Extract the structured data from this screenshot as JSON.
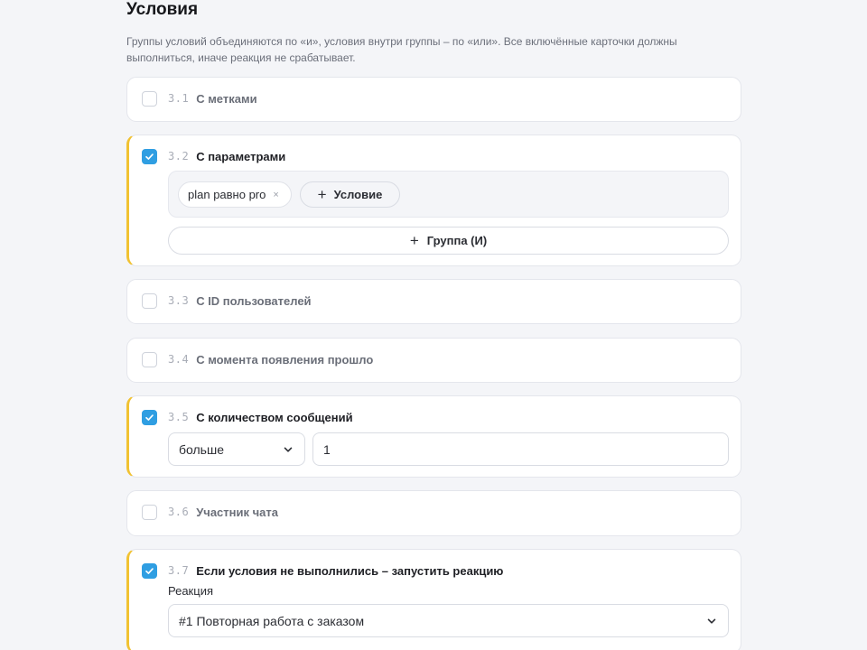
{
  "header": {
    "title": "Условия",
    "description": "Группы условий объединяются по «и», условия внутри группы – по «или». Все включённые карточки должны выполниться, иначе реакция не срабатывает."
  },
  "cards": [
    {
      "num": "3.1",
      "label": "С метками",
      "checked": false
    },
    {
      "num": "3.2",
      "label": "С параметрами",
      "checked": true
    },
    {
      "num": "3.3",
      "label": "С ID пользователей",
      "checked": false
    },
    {
      "num": "3.4",
      "label": "С момента появления прошло",
      "checked": false
    },
    {
      "num": "3.5",
      "label": "С количеством сообщений",
      "checked": true
    },
    {
      "num": "3.6",
      "label": "Участник чата",
      "checked": false
    },
    {
      "num": "3.7",
      "label": "Если условия не выполнились – запустить реакцию",
      "checked": true
    }
  ],
  "params": {
    "chip_label": "plan равно pro",
    "chip_remove": "×",
    "add_condition_icon": "+",
    "add_condition": "Условие",
    "add_group_icon": "+",
    "add_group": "Группа (И)"
  },
  "messages": {
    "operator": "больше",
    "value": "1"
  },
  "reaction": {
    "label": "Реакция",
    "selected": "#1 Повторная работа с заказом"
  },
  "colors": {
    "accent": "#2f9ee2",
    "active_border": "#f1c232"
  },
  "icons": {
    "checkbox_checked": "check-icon",
    "dropdown": "chevron-down-icon"
  }
}
